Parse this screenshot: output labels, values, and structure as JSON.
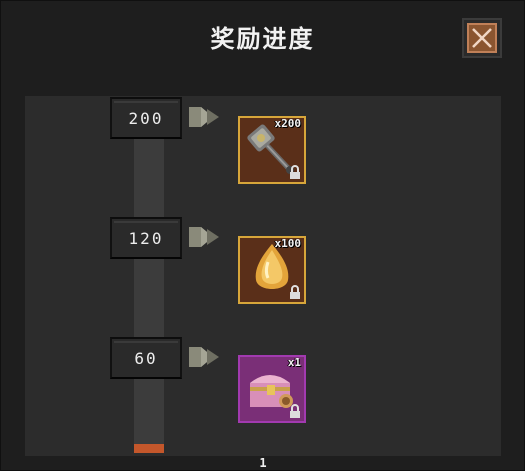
{
  "title": "奖励进度",
  "close_icon": "close-x-icon",
  "colors": {
    "progress_fill": "#c4572b",
    "gold_border": "#d7a63a",
    "purple_border": "#a23ab0"
  },
  "progress": {
    "current_value": 1
  },
  "milestones": [
    {
      "threshold": "200",
      "reward": {
        "item_icon": "mace-icon",
        "quantity": "x200",
        "rarity": "gold",
        "locked": true
      }
    },
    {
      "threshold": "120",
      "reward": {
        "item_icon": "amber-crystal-icon",
        "quantity": "x100",
        "rarity": "gold",
        "locked": true
      }
    },
    {
      "threshold": "60",
      "reward": {
        "item_icon": "treasure-chest-icon",
        "quantity": "x1",
        "rarity": "purple",
        "locked": true
      }
    }
  ],
  "page_indicator": "1"
}
